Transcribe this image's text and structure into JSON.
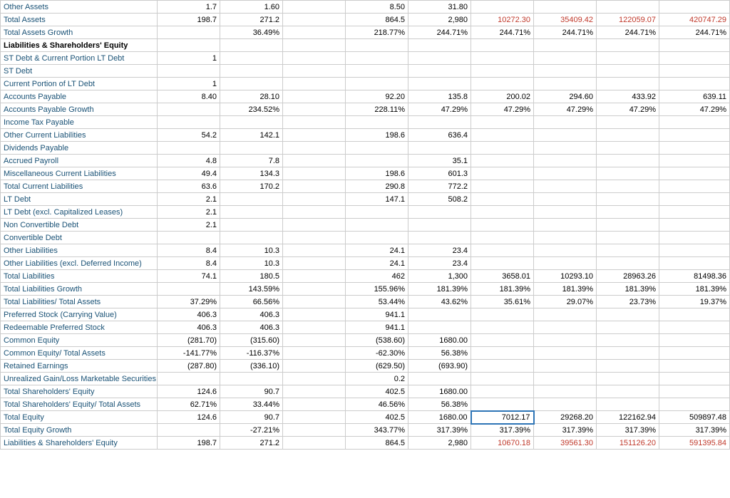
{
  "table": {
    "rows": [
      {
        "label": "Other Assets",
        "bold": false,
        "values": [
          "1.7",
          "1.60",
          "",
          "8.50",
          "31.80",
          "",
          "",
          "",
          ""
        ],
        "colors": [
          "",
          "",
          "",
          "",
          "",
          "",
          "",
          "",
          ""
        ]
      },
      {
        "label": "Total Assets",
        "bold": false,
        "values": [
          "198.7",
          "271.2",
          "",
          "864.5",
          "2,980",
          "10272.30",
          "35409.42",
          "122059.07",
          "420747.29"
        ],
        "colors": [
          "",
          "",
          "",
          "",
          "",
          "red",
          "red",
          "red",
          "red"
        ]
      },
      {
        "label": "Total Assets Growth",
        "bold": false,
        "values": [
          "",
          "36.49%",
          "",
          "218.77%",
          "244.71%",
          "244.71%",
          "244.71%",
          "244.71%",
          "244.71%"
        ],
        "colors": [
          "",
          "",
          "",
          "",
          "",
          "",
          "",
          "",
          ""
        ]
      },
      {
        "label": "Liabilities & Shareholders' Equity",
        "bold": true,
        "values": [
          "",
          "",
          "",
          "",
          "",
          "",
          "",
          "",
          ""
        ],
        "colors": []
      },
      {
        "label": "ST Debt & Current Portion LT Debt",
        "bold": false,
        "values": [
          "1",
          "",
          "",
          "",
          "",
          "",
          "",
          "",
          ""
        ],
        "colors": []
      },
      {
        "label": "ST Debt",
        "bold": false,
        "values": [
          "",
          "",
          "",
          "",
          "",
          "",
          "",
          "",
          ""
        ],
        "colors": []
      },
      {
        "label": "Current Portion of LT Debt",
        "bold": false,
        "values": [
          "1",
          "",
          "",
          "",
          "",
          "",
          "",
          "",
          ""
        ],
        "colors": []
      },
      {
        "label": "Accounts Payable",
        "bold": false,
        "values": [
          "8.40",
          "28.10",
          "",
          "92.20",
          "135.8",
          "200.02",
          "294.60",
          "433.92",
          "639.11"
        ],
        "colors": []
      },
      {
        "label": "Accounts Payable Growth",
        "bold": false,
        "values": [
          "",
          "234.52%",
          "",
          "228.11%",
          "47.29%",
          "47.29%",
          "47.29%",
          "47.29%",
          "47.29%"
        ],
        "colors": []
      },
      {
        "label": "Income Tax Payable",
        "bold": false,
        "values": [
          "",
          "",
          "",
          "",
          "",
          "",
          "",
          "",
          ""
        ],
        "colors": []
      },
      {
        "label": "Other Current Liabilities",
        "bold": false,
        "values": [
          "54.2",
          "142.1",
          "",
          "198.6",
          "636.4",
          "",
          "",
          "",
          ""
        ],
        "colors": []
      },
      {
        "label": "Dividends Payable",
        "bold": false,
        "values": [
          "",
          "",
          "",
          "",
          "",
          "",
          "",
          "",
          ""
        ],
        "colors": []
      },
      {
        "label": "Accrued Payroll",
        "bold": false,
        "values": [
          "4.8",
          "7.8",
          "",
          "",
          "35.1",
          "",
          "",
          "",
          ""
        ],
        "colors": []
      },
      {
        "label": "Miscellaneous Current Liabilities",
        "bold": false,
        "values": [
          "49.4",
          "134.3",
          "",
          "198.6",
          "601.3",
          "",
          "",
          "",
          ""
        ],
        "colors": []
      },
      {
        "label": "Total Current Liabilities",
        "bold": false,
        "values": [
          "63.6",
          "170.2",
          "",
          "290.8",
          "772.2",
          "",
          "",
          "",
          ""
        ],
        "colors": []
      },
      {
        "label": "LT Debt",
        "bold": false,
        "values": [
          "2.1",
          "",
          "",
          "147.1",
          "508.2",
          "",
          "",
          "",
          ""
        ],
        "colors": []
      },
      {
        "label": "LT Debt (excl. Capitalized Leases)",
        "bold": false,
        "values": [
          "2.1",
          "",
          "",
          "",
          "",
          "",
          "",
          "",
          ""
        ],
        "colors": []
      },
      {
        "label": "Non Convertible Debt",
        "bold": false,
        "values": [
          "2.1",
          "",
          "",
          "",
          "",
          "",
          "",
          "",
          ""
        ],
        "colors": []
      },
      {
        "label": "Convertible Debt",
        "bold": false,
        "values": [
          "",
          "",
          "",
          "",
          "",
          "",
          "",
          "",
          ""
        ],
        "colors": []
      },
      {
        "label": "Other Liabilities",
        "bold": false,
        "values": [
          "8.4",
          "10.3",
          "",
          "24.1",
          "23.4",
          "",
          "",
          "",
          ""
        ],
        "colors": []
      },
      {
        "label": "Other Liabilities (excl. Deferred Income)",
        "bold": false,
        "values": [
          "8.4",
          "10.3",
          "",
          "24.1",
          "23.4",
          "",
          "",
          "",
          ""
        ],
        "colors": []
      },
      {
        "label": "Total Liabilities",
        "bold": false,
        "values": [
          "74.1",
          "180.5",
          "",
          "462",
          "1,300",
          "3658.01",
          "10293.10",
          "28963.26",
          "81498.36"
        ],
        "colors": []
      },
      {
        "label": "Total Liabilities Growth",
        "bold": false,
        "values": [
          "",
          "143.59%",
          "",
          "155.96%",
          "181.39%",
          "181.39%",
          "181.39%",
          "181.39%",
          "181.39%"
        ],
        "colors": []
      },
      {
        "label": "Total Liabilities/ Total Assets",
        "bold": false,
        "values": [
          "37.29%",
          "66.56%",
          "",
          "53.44%",
          "43.62%",
          "35.61%",
          "29.07%",
          "23.73%",
          "19.37%"
        ],
        "colors": []
      },
      {
        "label": "Preferred Stock (Carrying Value)",
        "bold": false,
        "values": [
          "406.3",
          "406.3",
          "",
          "941.1",
          "",
          "",
          "",
          "",
          ""
        ],
        "colors": []
      },
      {
        "label": "Redeemable Preferred Stock",
        "bold": false,
        "values": [
          "406.3",
          "406.3",
          "",
          "941.1",
          "",
          "",
          "",
          "",
          ""
        ],
        "colors": []
      },
      {
        "label": "Common Equity",
        "bold": false,
        "values": [
          "(281.70)",
          "(315.60)",
          "",
          "(538.60)",
          "1680.00",
          "",
          "",
          "",
          ""
        ],
        "colors": []
      },
      {
        "label": "Common Equity/ Total Assets",
        "bold": false,
        "values": [
          "-141.77%",
          "-116.37%",
          "",
          "-62.30%",
          "56.38%",
          "",
          "",
          "",
          ""
        ],
        "colors": []
      },
      {
        "label": "Retained Earnings",
        "bold": false,
        "values": [
          "(287.80)",
          "(336.10)",
          "",
          "(629.50)",
          "(693.90)",
          "",
          "",
          "",
          ""
        ],
        "colors": []
      },
      {
        "label": "Unrealized Gain/Loss Marketable Securities",
        "bold": false,
        "values": [
          "",
          "",
          "",
          "0.2",
          "",
          "",
          "",
          "",
          ""
        ],
        "colors": []
      },
      {
        "label": "Total Shareholders' Equity",
        "bold": false,
        "values": [
          "124.6",
          "90.7",
          "",
          "402.5",
          "1680.00",
          "",
          "",
          "",
          ""
        ],
        "colors": []
      },
      {
        "label": "Total Shareholders' Equity/ Total Assets",
        "bold": false,
        "values": [
          "62.71%",
          "33.44%",
          "",
          "46.56%",
          "56.38%",
          "",
          "",
          "",
          ""
        ],
        "colors": []
      },
      {
        "label": "Total Equity",
        "bold": false,
        "values": [
          "124.6",
          "90.7",
          "",
          "402.5",
          "1680.00",
          "7012.17",
          "29268.20",
          "122162.94",
          "509897.48"
        ],
        "colors": [
          "",
          "",
          "",
          "",
          "",
          "blue-border",
          "",
          "",
          ""
        ]
      },
      {
        "label": "Total Equity Growth",
        "bold": false,
        "values": [
          "",
          "-27.21%",
          "",
          "343.77%",
          "317.39%",
          "317.39%",
          "317.39%",
          "317.39%",
          "317.39%"
        ],
        "colors": []
      },
      {
        "label": "Liabilities & Shareholders' Equity",
        "bold": false,
        "values": [
          "198.7",
          "271.2",
          "",
          "864.5",
          "2,980",
          "10670.18",
          "39561.30",
          "151126.20",
          "591395.84"
        ],
        "colors": [
          "",
          "",
          "",
          "",
          "",
          "red",
          "red",
          "red",
          "red"
        ]
      }
    ]
  }
}
